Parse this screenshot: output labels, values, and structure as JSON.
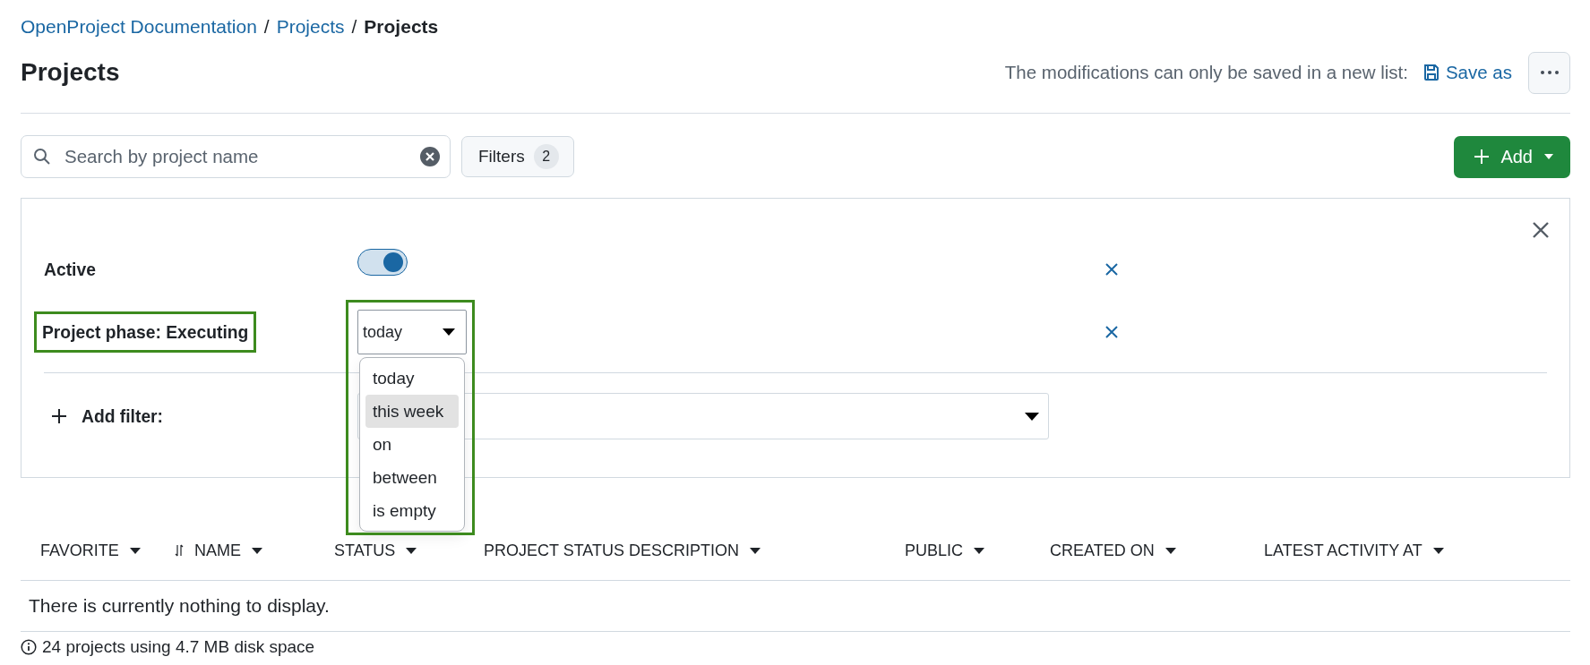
{
  "breadcrumb": {
    "separator": "/",
    "items": [
      {
        "label": "OpenProject Documentation",
        "link": true
      },
      {
        "label": "Projects",
        "link": true
      },
      {
        "label": "Projects",
        "link": false
      }
    ]
  },
  "page_title": "Projects",
  "header_note": "The modifications can only be saved in a new list:",
  "save_button": "Save as",
  "search": {
    "placeholder": "Search by project name"
  },
  "filters_button": {
    "label": "Filters",
    "count": "2"
  },
  "add_button": "Add",
  "filters": [
    {
      "kind": "toggle",
      "label": "Active",
      "on": true,
      "highlighted": false
    },
    {
      "kind": "select",
      "label": "Project phase: Executing",
      "value": "today",
      "highlighted": true
    }
  ],
  "operator_menu": {
    "options": [
      {
        "label": "today",
        "selected": false
      },
      {
        "label": "this week",
        "selected": true
      },
      {
        "label": "on",
        "selected": false
      },
      {
        "label": "between",
        "selected": false
      },
      {
        "label": "is empty",
        "selected": false
      }
    ]
  },
  "add_filter": {
    "label": "Add filter:"
  },
  "table": {
    "columns": [
      {
        "label": "FAVORITE"
      },
      {
        "label": "NAME"
      },
      {
        "label": "STATUS"
      },
      {
        "label": "PROJECT STATUS DESCRIPTION"
      },
      {
        "label": "PUBLIC"
      },
      {
        "label": "CREATED ON"
      },
      {
        "label": "LATEST ACTIVITY AT"
      }
    ],
    "empty_message": "There is currently nothing to display."
  },
  "footer": "24 projects using 4.7 MB disk space"
}
